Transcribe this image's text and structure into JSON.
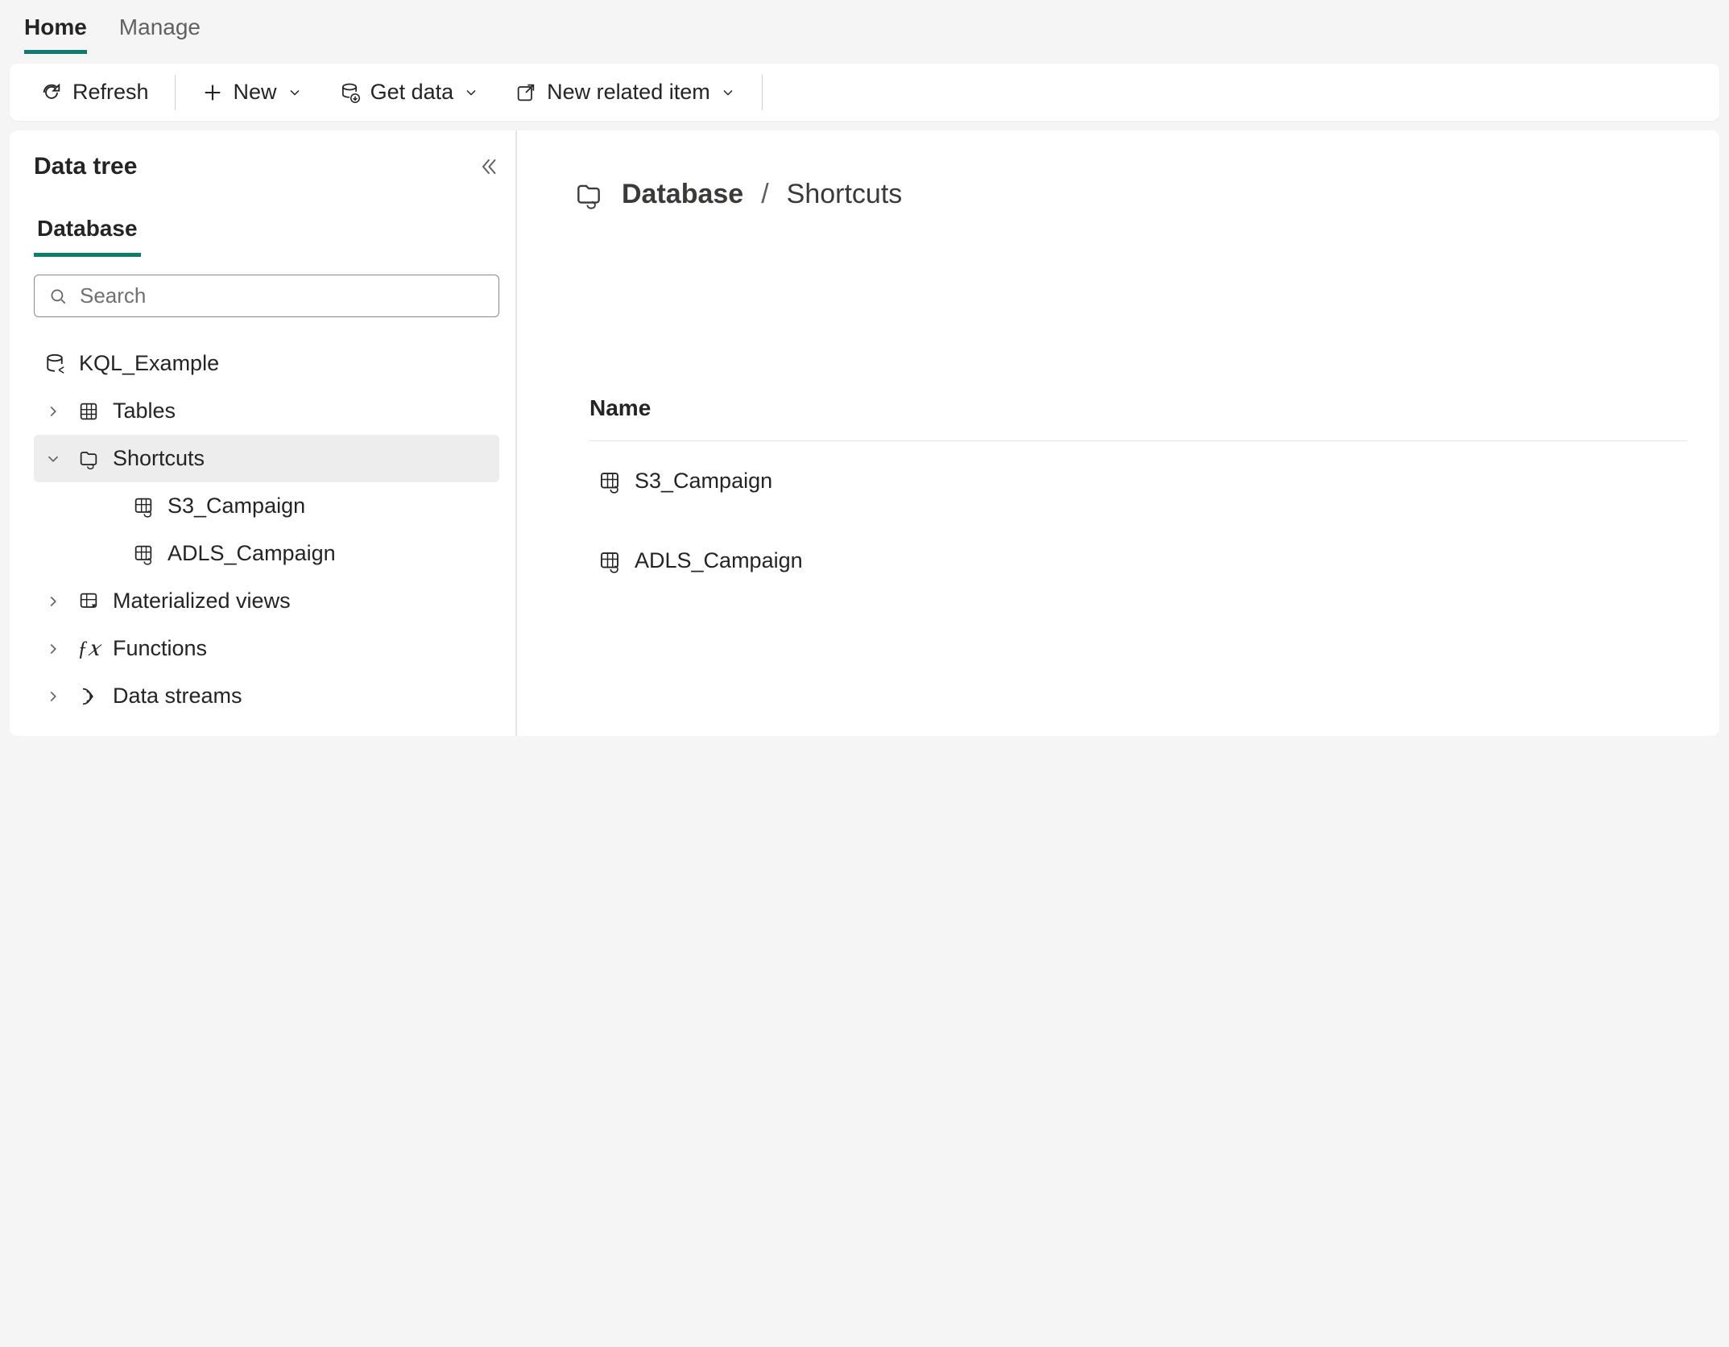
{
  "topTabs": {
    "home": "Home",
    "manage": "Manage"
  },
  "toolbar": {
    "refresh": "Refresh",
    "new": "New",
    "getData": "Get data",
    "newRelated": "New related item"
  },
  "sidebar": {
    "title": "Data tree",
    "tab": "Database",
    "searchPlaceholder": "Search",
    "dbName": "KQL_Example",
    "nodes": {
      "tables": "Tables",
      "shortcuts": "Shortcuts",
      "matViews": "Materialized views",
      "functions": "Functions",
      "dataStreams": "Data streams"
    },
    "shortcutItems": [
      "S3_Campaign",
      "ADLS_Campaign"
    ]
  },
  "main": {
    "breadcrumb": {
      "db": "Database",
      "current": "Shortcuts"
    },
    "columnHeader": "Name",
    "rows": [
      "S3_Campaign",
      "ADLS_Campaign"
    ]
  }
}
